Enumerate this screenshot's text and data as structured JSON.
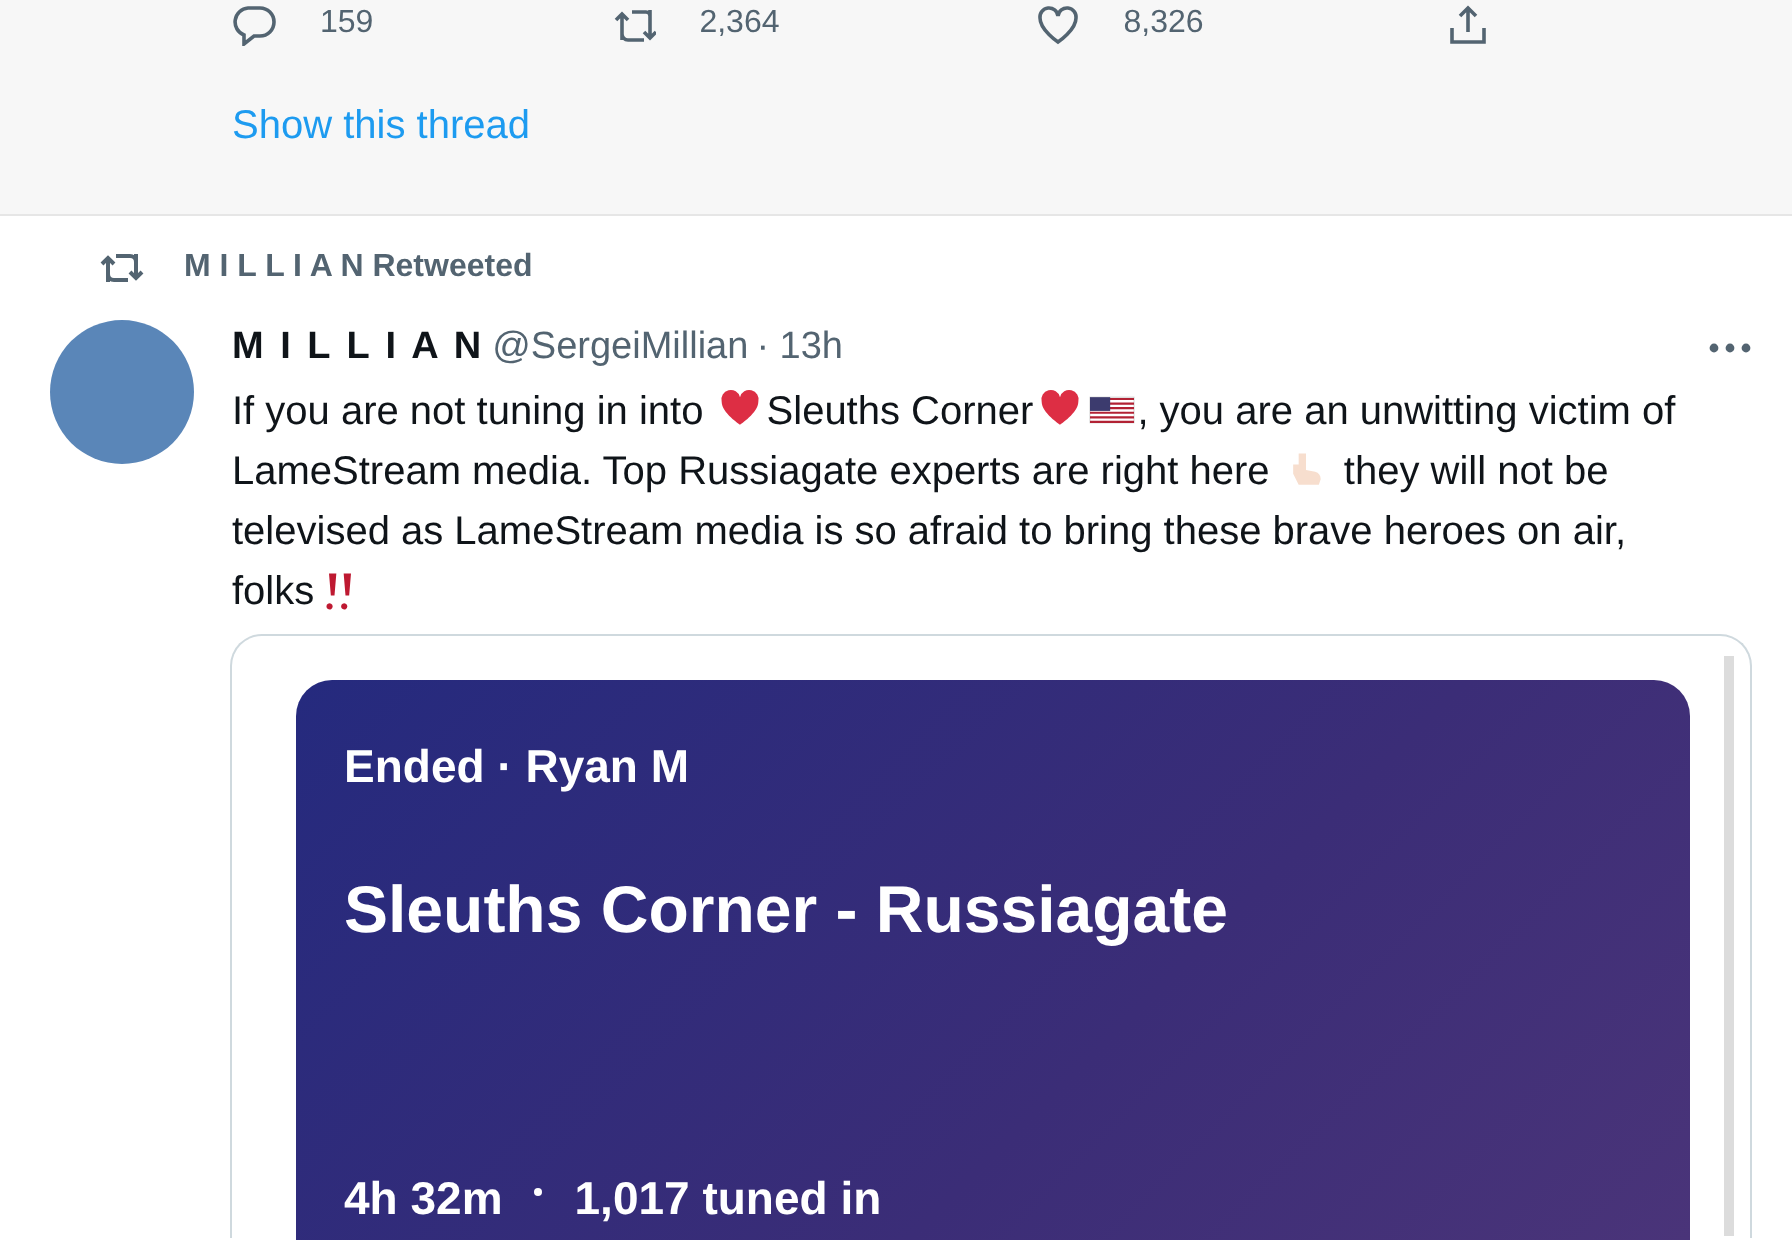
{
  "previous_tweet": {
    "actions": [
      {
        "kind": "reply",
        "count": "159"
      },
      {
        "kind": "retweet",
        "count": "2,364"
      },
      {
        "kind": "like",
        "count": "8,326"
      },
      {
        "kind": "share"
      }
    ],
    "show_thread": "Show this thread"
  },
  "tweet": {
    "retweeted_by": "M I L L I A N",
    "retweet_label": "Retweeted",
    "author_name": "M I L L I A N",
    "handle": "@SergeiMillian",
    "time": "· 13h",
    "text": [
      {
        "kind": "text",
        "text": "If you are not tuning in into "
      },
      {
        "kind": "heart"
      },
      {
        "kind": "text",
        "text": "Sleuths Corner"
      },
      {
        "kind": "heart"
      },
      {
        "kind": "flag"
      },
      {
        "kind": "text",
        "text": ", you are an unwitting victim of LameStream media. Top Russiagate experts are right here "
      },
      {
        "kind": "hand"
      },
      {
        "kind": "text",
        "text": " they will not be televised as LameStream media is so afraid to bring these brave heroes on air, folks"
      },
      {
        "kind": "double_exclamation"
      }
    ],
    "space_card": {
      "status": "Ended · Ryan M",
      "title": "Sleuths Corner - Russiagate",
      "duration": "4h 32m",
      "listeners": "1,017 tuned in"
    }
  }
}
